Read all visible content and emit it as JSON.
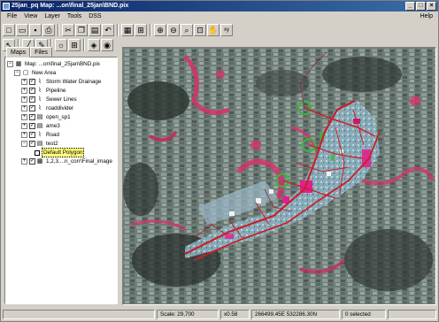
{
  "window": {
    "title": "25jan_pq  Map: ...on\\final_25jan\\BND.pix"
  },
  "menu": [
    "File",
    "View",
    "Layer",
    "Tools",
    "DSS"
  ],
  "menu_help": "Help",
  "toolbar1": [
    {
      "name": "new-icon",
      "glyph": "□"
    },
    {
      "name": "open-icon",
      "glyph": "▭"
    },
    {
      "name": "save-icon",
      "glyph": "▪"
    },
    {
      "name": "print-icon",
      "glyph": "⎙"
    },
    {
      "name": "cut-icon",
      "glyph": "✂"
    },
    {
      "name": "copy-icon",
      "glyph": "❐"
    },
    {
      "name": "paste-icon",
      "glyph": "▤"
    },
    {
      "name": "undo-icon",
      "glyph": "↶"
    },
    {
      "name": "map-icon",
      "glyph": "▦"
    },
    {
      "name": "zoom-extent-icon",
      "glyph": "⊞"
    },
    {
      "name": "zoom-in-icon",
      "glyph": "⊕"
    },
    {
      "name": "zoom-out-icon",
      "glyph": "⊖"
    },
    {
      "name": "zoom-box-icon",
      "glyph": "⌕"
    },
    {
      "name": "zoom-window-icon",
      "glyph": "⊡"
    },
    {
      "name": "pan-hand-icon",
      "glyph": "✋"
    },
    {
      "name": "coordinate-icon",
      "glyph": "xy"
    }
  ],
  "toolbar2": [
    {
      "name": "select-arrow-icon",
      "glyph": "↖"
    },
    {
      "name": "draw-line-icon",
      "glyph": "╱"
    },
    {
      "name": "edit-vertex-icon",
      "glyph": "✎"
    },
    {
      "name": "sun-icon",
      "glyph": "☼"
    },
    {
      "name": "layer-add-icon",
      "glyph": "⊞"
    },
    {
      "name": "layers-icon",
      "glyph": "◈"
    },
    {
      "name": "eye-icon",
      "glyph": "◉"
    }
  ],
  "tabs": [
    "Maps",
    "Files"
  ],
  "tree": {
    "root": "Map: ...on\\final_25jan\\BND.pix",
    "area": "New Area",
    "layers": [
      "Storm Water Drainage",
      "Pipeline",
      "Sewer Lines",
      "roaddivider",
      "open_sp1",
      "ame3",
      "Road",
      "test2"
    ],
    "sublayer": "Default Polygon",
    "image": "1,2,3....n_corr\\Final_image"
  },
  "status": {
    "scale": "Scale: 29,700",
    "zoom": "x0.58",
    "coords": "266499.45E 532286.30N",
    "selected": "0 selected"
  },
  "colors": {
    "titlebar_start": "#0a246a",
    "titlebar_end": "#3a6ea5",
    "road": "#c8202a",
    "vegetation_red": "#d8306a",
    "zone_magenta": "#e0208c",
    "zone_green": "#3cb43c",
    "background_field": "#6a7a78"
  }
}
